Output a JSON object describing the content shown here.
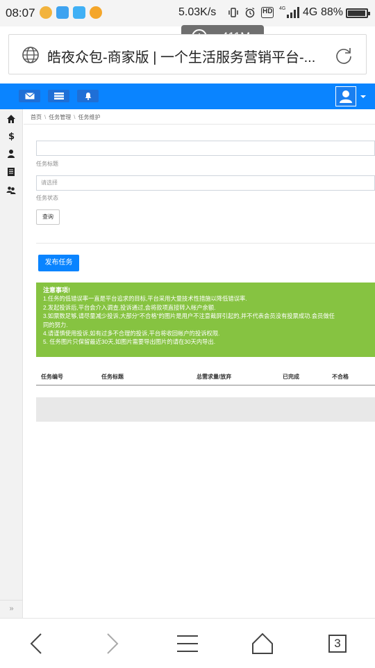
{
  "status_bar": {
    "time": "08:07",
    "net_speed": "5.03K/s",
    "hd_label": "HD",
    "network_type": "4G",
    "small_tag": "4G",
    "battery_percent": "88%",
    "battery_level": 0.88
  },
  "mem_badge": {
    "value": "411M"
  },
  "browser": {
    "page_title": "皓夜众包-商家版 | 一个生活服务营销平台-..."
  },
  "sidebar": {
    "items": [
      {
        "icon": "home-icon"
      },
      {
        "icon": "dollar-icon"
      },
      {
        "icon": "user-icon"
      },
      {
        "icon": "book-icon"
      },
      {
        "icon": "users-icon"
      }
    ],
    "collapse_label": "»"
  },
  "breadcrumb": {
    "home": "首页",
    "parent": "任务管理",
    "current": "任务维护",
    "separator": "\\"
  },
  "form": {
    "title_label": "任务标题",
    "status_placeholder": "请选择",
    "status_label": "任务状态",
    "query_label": "查询"
  },
  "publish_label": "发布任务",
  "notice": {
    "title": "注意事项!",
    "lines": [
      "1.任务的低错误率一直是平台追求的目标,平台采用大量技术性措施以降低错误率.",
      "2.发起投诉后,平台会介入调查,投诉通过,会将款项直接转入帐户余额.",
      "3.如票数足够,请尽量减少投诉,大部分“不合格”的图片是用户不注意截屏引起的,并不代表会员没有投票成功.会员做任",
      "同的努力.",
      "4.请谨慎使用投诉,如有过多不合理的投诉,平台将收回帐户的投诉权限.",
      "5. 任务图片只保留最近30天,如图片需要导出图片的请在30天内导出."
    ]
  },
  "table": {
    "headers": [
      "任务编号",
      "任务标题",
      "总需求量/放弃",
      "已完成",
      "不合格"
    ]
  },
  "bottom_nav": {
    "tabs_count": "3"
  },
  "colors": {
    "brand_blue": "#0a84ff",
    "notice_green": "#86c341"
  }
}
